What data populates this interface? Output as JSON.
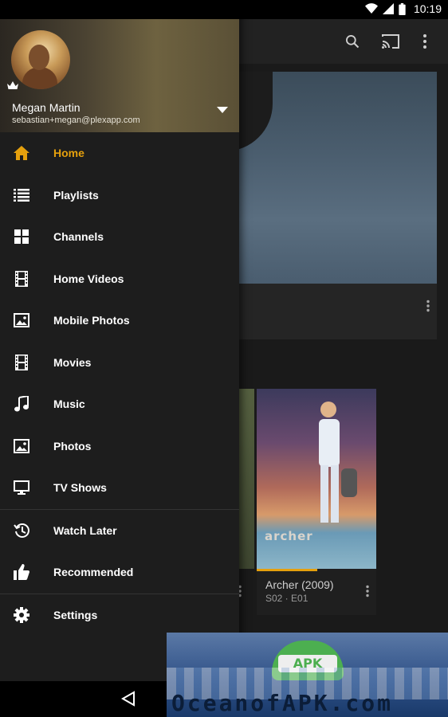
{
  "status_bar": {
    "time": "10:19"
  },
  "user": {
    "name": "Megan Martin",
    "email": "sebastian+megan@plexapp.com"
  },
  "menu": {
    "items": [
      {
        "label": "Home",
        "icon": "home-icon",
        "active": true
      },
      {
        "label": "Playlists",
        "icon": "playlist-icon"
      },
      {
        "label": "Channels",
        "icon": "grid-icon"
      },
      {
        "label": "Home Videos",
        "icon": "film-icon"
      },
      {
        "label": "Mobile Photos",
        "icon": "image-icon"
      },
      {
        "label": "Movies",
        "icon": "film-icon"
      },
      {
        "label": "Music",
        "icon": "music-note-icon"
      },
      {
        "label": "Photos",
        "icon": "image-icon"
      },
      {
        "label": "TV Shows",
        "icon": "monitor-icon"
      }
    ],
    "secondary": [
      {
        "label": "Watch Later",
        "icon": "history-icon"
      },
      {
        "label": "Recommended",
        "icon": "thumbs-up-icon"
      }
    ],
    "settings": {
      "label": "Settings",
      "icon": "gear-icon"
    }
  },
  "content": {
    "archer": {
      "logo": "archer",
      "title": "Archer (2009)",
      "subtitle": "S02 · E01"
    }
  },
  "watermark": {
    "badge": "APK",
    "text": "OceanofAPK.com"
  },
  "colors": {
    "accent": "#e5a00d",
    "drawer": "#1d1d1d",
    "background": "#111111"
  }
}
